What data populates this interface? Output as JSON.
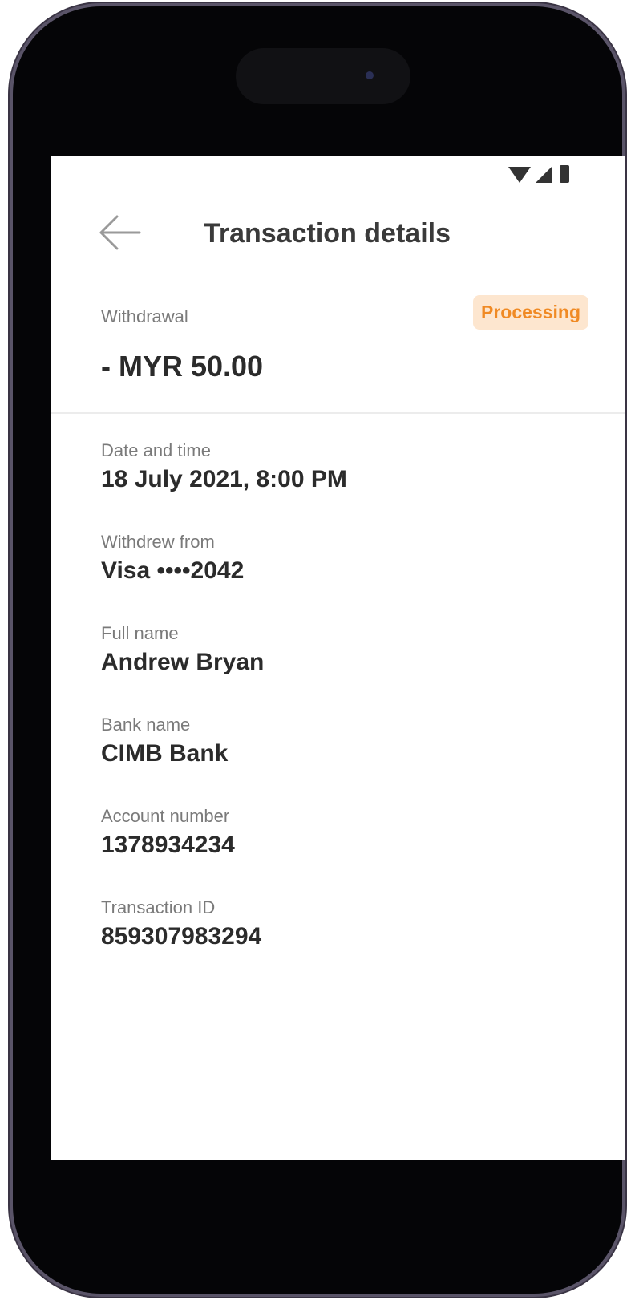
{
  "header": {
    "title": "Transaction details",
    "back_icon": "arrow-left-icon"
  },
  "summary": {
    "type": "Withdrawal",
    "status": "Processing",
    "amount": "- MYR 50.00",
    "status_color": "#f08a24",
    "status_bg": "#fde6cf"
  },
  "details": [
    {
      "label": "Date and time",
      "value": "18 July 2021, 8:00 PM"
    },
    {
      "label": "Withdrew from",
      "value": "Visa ••••2042"
    },
    {
      "label": "Full name",
      "value": "Andrew Bryan"
    },
    {
      "label": "Bank name",
      "value": "CIMB Bank"
    },
    {
      "label": "Account number",
      "value": "1378934234"
    },
    {
      "label": "Transaction ID",
      "value": "859307983294"
    }
  ],
  "status_bar": {
    "icons": [
      "wifi-icon",
      "cellular-signal-icon",
      "battery-icon"
    ]
  }
}
